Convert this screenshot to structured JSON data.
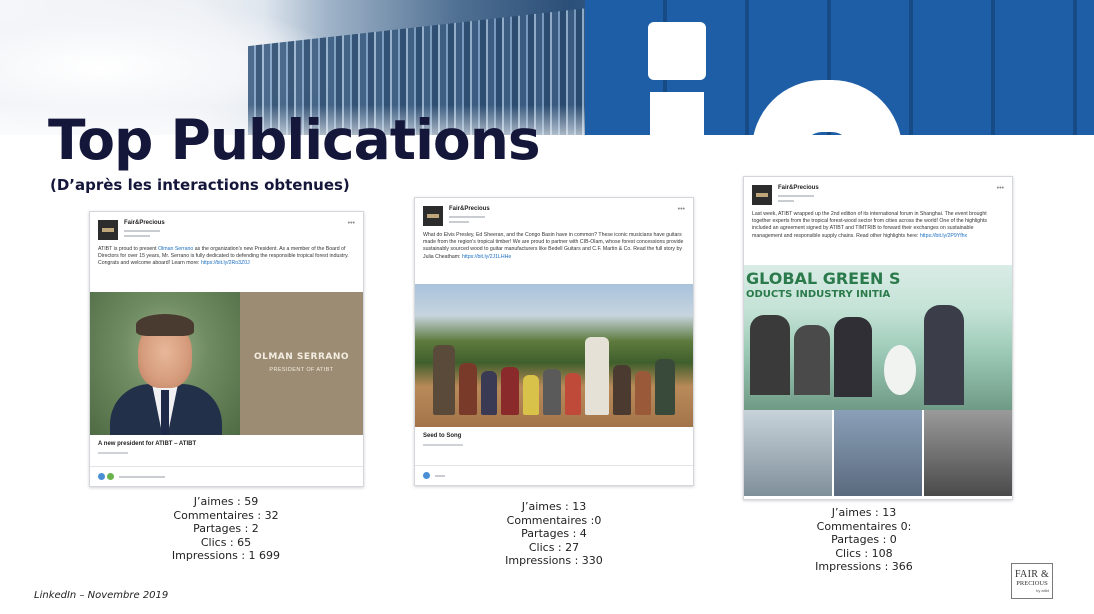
{
  "slide": {
    "title": "Top Publications",
    "subtitle": "(D’après les interactions obtenues)",
    "footnote": "LinkedIn – Novembre 2019",
    "logo": {
      "line1": "FAIR &",
      "line2": "PRECIOUS",
      "line3": "by atibt"
    }
  },
  "posts": [
    {
      "author": "Fair&Precious",
      "text": "ATIBT is proud to present",
      "text_link": "Olman Serrano",
      "text_rest": "as the organization's new President. As a member of the Board of Directors for over 15 years, Mr. Serrano is fully dedicated to defending the responsible tropical forest industry. Congrats and welcome aboard! Learn more:",
      "url": "https://bit.ly/2Ro3Z0J",
      "image_name": "OLMAN SERRANO",
      "image_role": "PRESIDENT OF ATIBT",
      "caption": "A new president for ATIBT – ATIBT",
      "stats": {
        "likes": "J’aimes : 59",
        "comments": "Commentaires : 32",
        "shares": "Partages : 2",
        "clicks": "Clics : 65",
        "impressions": "Impressions : 1 699"
      }
    },
    {
      "author": "Fair&Precious",
      "text": "What do Elvis Presley, Ed Sheeran, and the Congo Basin have in common? These iconic musicians have guitars made from the region's tropical timber! We are proud to partner with CIB-Olam, whose forest concessions provide sustainably sourced wood to guitar manufacturers like Bedell Guitars and C.F. Martin & Co. Read the full story by Julia Cheatham:",
      "url": "https://bit.ly/2J1LHHe",
      "caption": "Seed to Song",
      "stats": {
        "likes": "J’aimes : 13",
        "comments": "Commentaires :0",
        "shares": "Partages : 4",
        "clicks": "Clics : 27",
        "impressions": "Impressions : 330"
      }
    },
    {
      "author": "Fair&Precious",
      "text": "Last week, ATIBT wrapped up the 2nd edition of its international forum in Shanghai. The event brought together experts from the tropical forest-wood sector from cities across the world! One of the highlights included an agreement signed by ATIBT and TIMTRIB to forward their exchanges on sustainable management and responsible supply chains. Read other highlights here:",
      "url": "https://bit.ly/2P9Yfhx",
      "banner_line1": "GLOBAL GREEN S",
      "banner_line2": "ODUCTS INDUSTRY INITIA",
      "stats": {
        "likes": "J’aimes : 13",
        "comments": "Commentaires 0:",
        "shares": "Partages : 0",
        "clicks": "Clics : 108",
        "impressions": "Impressions : 366"
      }
    }
  ],
  "colors": {
    "title": "#14163a",
    "linkedin_blue": "#1e5ea6",
    "link": "#1b6fc2"
  }
}
